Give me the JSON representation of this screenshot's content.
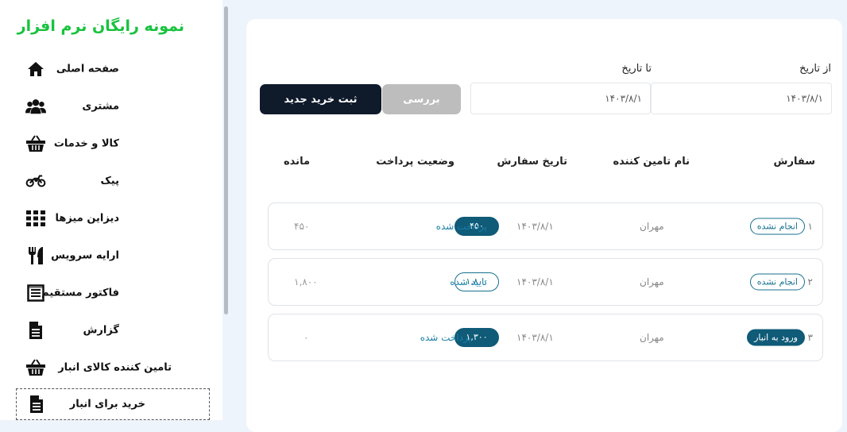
{
  "brand": {
    "title": "نمونه رایگان نرم افزار",
    "color": "#18c23e"
  },
  "sidebar": {
    "items": [
      {
        "label": "صفحه اصلی",
        "icon": "home-icon"
      },
      {
        "label": "مشتری",
        "icon": "users-icon"
      },
      {
        "label": "کالا و خدمات",
        "icon": "basket-icon"
      },
      {
        "label": "پیک",
        "icon": "motorcycle-icon"
      },
      {
        "label": "دیزاین میزها",
        "icon": "grid-icon"
      },
      {
        "label": "ارایه سرویس",
        "icon": "utensils-icon"
      },
      {
        "label": "فاکتور مستقیم",
        "icon": "invoice-icon"
      },
      {
        "label": "گزارش",
        "icon": "document-icon"
      },
      {
        "label": "تامین کننده کالای انبار",
        "icon": "basket-icon"
      },
      {
        "label": "خرید برای انبار",
        "icon": "document-icon",
        "active": true
      }
    ]
  },
  "filters": {
    "from_label": "از تاریخ",
    "to_label": "تا تاریخ",
    "from_value": "۱۴۰۳/۸/۱",
    "to_value": "۱۴۰۳/۸/۱"
  },
  "buttons": {
    "check": "بررسی",
    "new_purchase": "ثبت خرید جدید"
  },
  "table": {
    "headers": {
      "order": "سفارش",
      "supplier": "نام تامین کننده",
      "date": "تاریخ سفارش",
      "payment": "وضعیت پرداخت",
      "remaining": "مانده"
    },
    "rows": [
      {
        "index": "۱",
        "status": "انجام نشده",
        "status_filled": false,
        "supplier": "مهران",
        "date": "۱۴۰۳/۸/۱",
        "amount": "۴۵۰",
        "amount_filled": true,
        "payment_status": "پرداخت شده",
        "remaining": "۴۵۰"
      },
      {
        "index": "۲",
        "status": "انجام نشده",
        "status_filled": false,
        "supplier": "مهران",
        "date": "۱۴۰۳/۸/۱",
        "amount": "۱,۸۰۰",
        "amount_filled": false,
        "payment_status": "تایید شده",
        "remaining": "۱,۸۰۰"
      },
      {
        "index": "۳",
        "status": "ورود به انبار",
        "status_filled": true,
        "supplier": "مهران",
        "date": "۱۴۰۳/۸/۱",
        "amount": "۱,۳۰۰",
        "amount_filled": true,
        "payment_status": "پرداخت شده",
        "remaining": "۰"
      }
    ]
  },
  "colors": {
    "accent": "#0f5b78",
    "dark_button": "#0f1a2b",
    "muted_button": "#bdbdbd"
  }
}
